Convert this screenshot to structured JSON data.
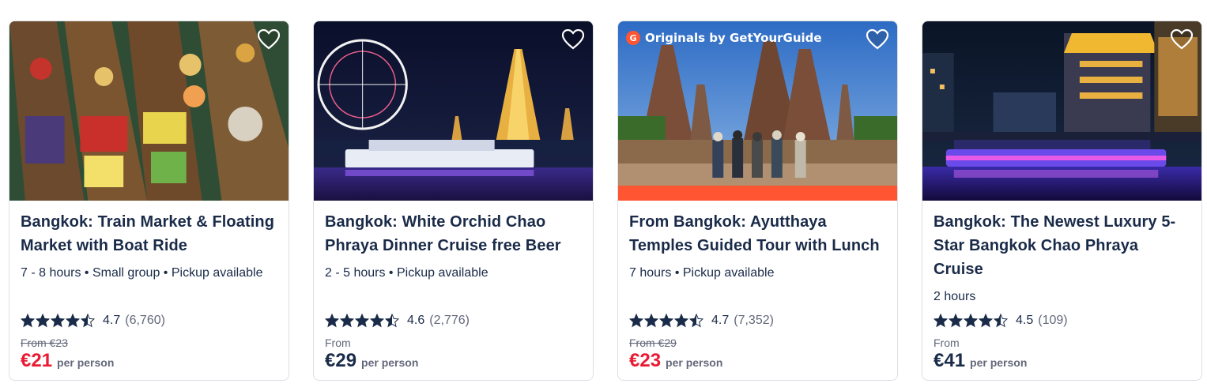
{
  "cards": [
    {
      "title": "Bangkok: Train Market & Floating Market with Boat Ride",
      "meta": "7 - 8 hours • Small group • Pickup available",
      "rating": "4.7",
      "reviews": "(6,760)",
      "stars": 4.7,
      "from_label": "From €23",
      "price": "€21",
      "per_person": "per person",
      "on_sale": true
    },
    {
      "title": "Bangkok: White Orchid Chao Phraya Dinner Cruise free Beer",
      "meta": "2 - 5 hours • Pickup available",
      "rating": "4.6",
      "reviews": "(2,776)",
      "stars": 4.6,
      "from_label": "From",
      "price": "€29",
      "per_person": "per person",
      "on_sale": false
    },
    {
      "badge_letter": "G",
      "badge_text": "Originals by GetYourGuide",
      "title": "From Bangkok: Ayutthaya Temples Guided Tour with Lunch",
      "meta": "7 hours • Pickup available",
      "rating": "4.7",
      "reviews": "(7,352)",
      "stars": 4.7,
      "from_label": "From €29",
      "price": "€23",
      "per_person": "per person",
      "on_sale": true
    },
    {
      "title": "Bangkok: The Newest Luxury 5-Star Bangkok Chao Phraya Cruise",
      "meta": "2 hours",
      "rating": "4.5",
      "reviews": "(109)",
      "stars": 4.5,
      "from_label": "From",
      "price": "€41",
      "per_person": "per person",
      "on_sale": false
    }
  ],
  "colors": {
    "text": "#1a2b49",
    "muted": "#63687a",
    "sale": "#eb1a33",
    "brand_orange": "#ff5533"
  },
  "icons": [
    "heart-icon",
    "star-icon",
    "half-star-icon"
  ]
}
